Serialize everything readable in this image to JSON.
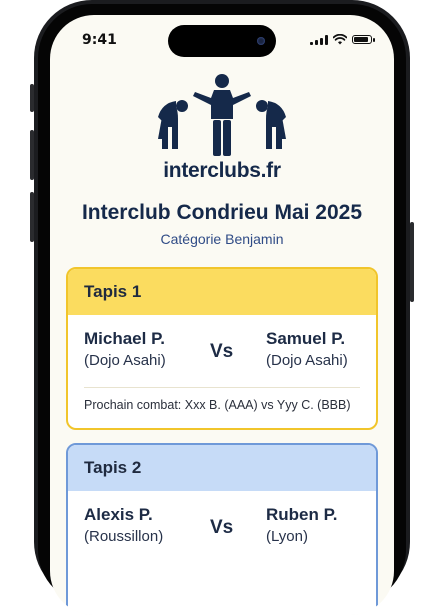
{
  "status_bar": {
    "time": "9:41"
  },
  "logo": {
    "text": "interclubs.fr",
    "icon": "judo-bowing-figures"
  },
  "event": {
    "title": "Interclub Condrieu Mai 2025",
    "category": "Catégorie Benjamin"
  },
  "mats": [
    {
      "label": "Tapis 1",
      "header_color": "#fbdc5f",
      "border_color": "#f1c52b",
      "player_left": {
        "name": "Michael P.",
        "club": "(Dojo Asahi)"
      },
      "versus": "Vs",
      "player_right": {
        "name": "Samuel P.",
        "club": "(Dojo Asahi)"
      },
      "next_match": "Prochain combat: Xxx B. (AAA) vs Yyy C. (BBB)"
    },
    {
      "label": "Tapis 2",
      "header_color": "#c6dbf7",
      "border_color": "#6f99d8",
      "player_left": {
        "name": "Alexis P.",
        "club": "(Roussillon)"
      },
      "versus": "Vs",
      "player_right": {
        "name": "Ruben P.",
        "club": "(Lyon)"
      }
    }
  ]
}
